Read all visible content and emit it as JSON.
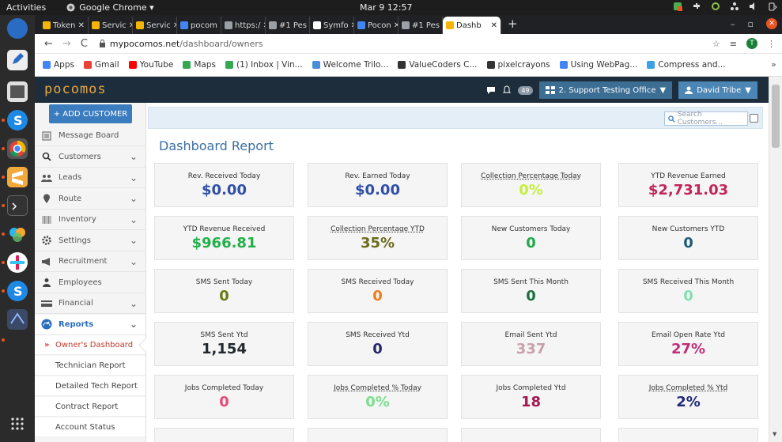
{
  "os": {
    "activities": "Activities",
    "app_menu": "Google Chrome ▾",
    "clock": "Mar 9  12:57"
  },
  "browser": {
    "tabs": [
      {
        "label": "Token",
        "icon": "star-flag-icon",
        "color": "#f4b400"
      },
      {
        "label": "Servic",
        "icon": "star-flag-icon",
        "color": "#f4b400"
      },
      {
        "label": "Servic",
        "icon": "star-flag-icon",
        "color": "#f4b400"
      },
      {
        "label": "pocom",
        "icon": "p-square-icon",
        "color": "#4285f4"
      },
      {
        "label": "https:/",
        "icon": "globe-icon",
        "color": "#9aa0a6"
      },
      {
        "label": "#1 Pes",
        "icon": "globe-icon",
        "color": "#9aa0a6"
      },
      {
        "label": "Symfo",
        "icon": "symfony-icon",
        "color": "#ffffff"
      },
      {
        "label": "Pocon",
        "icon": "doc-icon",
        "color": "#4285f4"
      },
      {
        "label": "#1 Pes",
        "icon": "globe-icon",
        "color": "#9aa0a6"
      },
      {
        "label": "Dashb",
        "icon": "star-flag-icon",
        "color": "#f4b400"
      }
    ],
    "new_tab": "+",
    "url_host": "mypocomos.net",
    "url_path": "/dashboard/owners",
    "profile_initial": "T",
    "bookmarks": [
      {
        "label": "Apps",
        "icon": "apps-grid-icon",
        "color": "#4285f4"
      },
      {
        "label": "Gmail",
        "icon": "google-g-icon",
        "color": "#ea4335"
      },
      {
        "label": "YouTube",
        "icon": "youtube-icon",
        "color": "#ff0000"
      },
      {
        "label": "Maps",
        "icon": "map-pin-icon",
        "color": "#34a853"
      },
      {
        "label": "(1) Inbox | Vin...",
        "icon": "inbox-icon",
        "color": "#34a853"
      },
      {
        "label": "Welcome Trilo...",
        "icon": "trilogy-icon",
        "color": "#4a8fd8"
      },
      {
        "label": "ValueCoders C...",
        "icon": "vc-icon",
        "color": "#333333"
      },
      {
        "label": "pixelcrayons",
        "icon": "pc-icon",
        "color": "#333333"
      },
      {
        "label": "Using WebPag...",
        "icon": "google-g-icon",
        "color": "#4285f4"
      },
      {
        "label": "Compress and...",
        "icon": "compress-icon",
        "color": "#3aa0e8"
      }
    ],
    "more": "»"
  },
  "app": {
    "logo": "pocomos",
    "notif_count": "49",
    "office": "2. Support Testing Office",
    "user": "David Tribe"
  },
  "sidebar": {
    "add_customer": "+ ADD CUSTOMER",
    "items": [
      {
        "label": "Message Board",
        "icon": "message-board-icon",
        "chev": ""
      },
      {
        "label": "Customers",
        "icon": "search-icon",
        "chev": "⌄"
      },
      {
        "label": "Leads",
        "icon": "leads-icon",
        "chev": "⌄"
      },
      {
        "label": "Route",
        "icon": "map-pin-icon",
        "chev": "⌄"
      },
      {
        "label": "Inventory",
        "icon": "barcode-icon",
        "chev": "⌄"
      },
      {
        "label": "Settings",
        "icon": "gear-icon",
        "chev": "⌄"
      },
      {
        "label": "Recruitment",
        "icon": "megaphone-icon",
        "chev": "⌄"
      },
      {
        "label": "Employees",
        "icon": "user-icon",
        "chev": ""
      },
      {
        "label": "Financial",
        "icon": "money-icon",
        "chev": "⌄"
      },
      {
        "label": "Reports",
        "icon": "dashboard-gauge-icon",
        "chev": "⌄"
      }
    ],
    "sub": [
      {
        "label": "Owner's Dashboard"
      },
      {
        "label": "Technician Report"
      },
      {
        "label": "Detailed Tech Report"
      },
      {
        "label": "Contract Report"
      },
      {
        "label": "Account Status"
      }
    ]
  },
  "main": {
    "search_placeholder": "Search Customers...",
    "title": "Dashboard Report",
    "cards": [
      {
        "label": "Rev. Received Today",
        "value": "$0.00",
        "color": "#2f4fa8"
      },
      {
        "label": "Rev. Earned Today",
        "value": "$0.00",
        "color": "#2f4fa8"
      },
      {
        "label": "Collection Percentage Today",
        "value": "0%",
        "color": "#c7ef3a"
      },
      {
        "label": "YTD Revenue Earned",
        "value": "$2,731.03",
        "color": "#c0245a"
      },
      {
        "label": "YTD Revenue Received",
        "value": "$966.81",
        "color": "#22b04a"
      },
      {
        "label": "Collection Percentage YTD",
        "value": "35%",
        "color": "#6b6b1e"
      },
      {
        "label": "New Customers Today",
        "value": "0",
        "color": "#20a84a"
      },
      {
        "label": "New Customers YTD",
        "value": "0",
        "color": "#1d5a7a"
      },
      {
        "label": "SMS Sent Today",
        "value": "0",
        "color": "#6b7a12"
      },
      {
        "label": "SMS Received Today",
        "value": "0",
        "color": "#f07d1b"
      },
      {
        "label": "SMS Sent This Month",
        "value": "0",
        "color": "#1f6f3e"
      },
      {
        "label": "SMS Received This Month",
        "value": "0",
        "color": "#7fe0b4"
      },
      {
        "label": "SMS Sent Ytd",
        "value": "1,154",
        "color": "#23282f"
      },
      {
        "label": "SMS Received Ytd",
        "value": "0",
        "color": "#27276a"
      },
      {
        "label": "Email Sent Ytd",
        "value": "337",
        "color": "#c8a0aa"
      },
      {
        "label": "Email Open Rate Ytd",
        "value": "27%",
        "color": "#c12e78"
      },
      {
        "label": "Jobs Completed Today",
        "value": "0",
        "color": "#ea4a78"
      },
      {
        "label": "Jobs Completed % Today",
        "value": "0%",
        "color": "#7adf8c"
      },
      {
        "label": "Jobs Completed Ytd",
        "value": "18",
        "color": "#a6174f"
      },
      {
        "label": "Jobs Completed % Ytd",
        "value": "2%",
        "color": "#1f2a7a"
      }
    ]
  }
}
